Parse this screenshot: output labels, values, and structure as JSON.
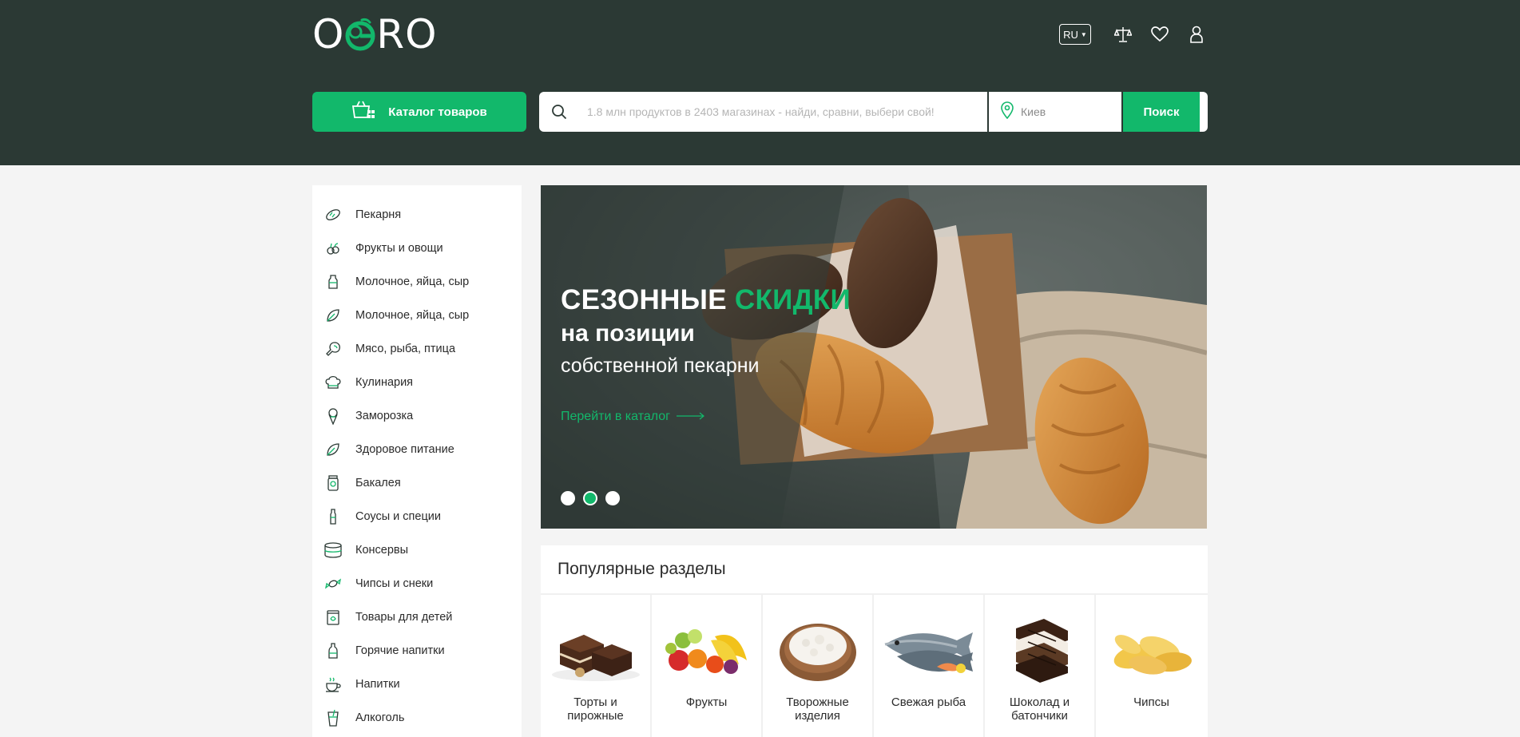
{
  "header": {
    "logo_text_left": "O",
    "logo_text_right": "RO",
    "lang": "RU",
    "icons": [
      "compare-scales-icon",
      "heart-icon",
      "user-icon"
    ]
  },
  "catalog_button": "Каталог товаров",
  "search": {
    "placeholder": "1.8 млн продуктов в 2403 магазинах - найди, сравни, выбери свой!",
    "city_placeholder": "Киев",
    "button": "Поиск"
  },
  "sidebar": {
    "items": [
      {
        "label": "Пекарня",
        "icon": "bread-icon"
      },
      {
        "label": "Фрукты и овощи",
        "icon": "fruit-icon"
      },
      {
        "label": "Молочное, яйца, сыр",
        "icon": "milk-icon"
      },
      {
        "label": "Молочное, яйца, сыр",
        "icon": "leaf-icon"
      },
      {
        "label": "Мясо, рыба, птица",
        "icon": "chicken-leg-icon"
      },
      {
        "label": "Кулинария",
        "icon": "chef-hat-icon"
      },
      {
        "label": "Заморозка",
        "icon": "ice-cream-icon"
      },
      {
        "label": "Здоровое питание",
        "icon": "leaf-icon"
      },
      {
        "label": "Бакалея",
        "icon": "jar-icon"
      },
      {
        "label": "Соусы и специи",
        "icon": "sauce-bottle-icon"
      },
      {
        "label": "Консервы",
        "icon": "can-icon"
      },
      {
        "label": "Чипсы и снеки",
        "icon": "candy-icon"
      },
      {
        "label": "Товары для детей",
        "icon": "baby-food-icon"
      },
      {
        "label": "Горячие напитки",
        "icon": "bottle-icon"
      },
      {
        "label": "Напитки",
        "icon": "coffee-cup-icon"
      },
      {
        "label": "Алкоголь",
        "icon": "cocktail-icon"
      }
    ]
  },
  "banner": {
    "line1_white": "СЕЗОННЫЕ",
    "line1_green": "СКИДКИ",
    "line2": "на позиции",
    "line3": "собственной пекарни",
    "link": "Перейти в каталог",
    "active_slide": 2,
    "slides": 3
  },
  "popular": {
    "title": "Популярные разделы",
    "cards": [
      {
        "label": "Торты и пирожные",
        "image": "cakes"
      },
      {
        "label": "Фрукты",
        "image": "fruits"
      },
      {
        "label": "Творожные изделия",
        "image": "cottage-cheese"
      },
      {
        "label": "Свежая рыба",
        "image": "fish"
      },
      {
        "label": "Шоколад и батончики",
        "image": "chocolate"
      },
      {
        "label": "Чипсы",
        "image": "chips"
      }
    ]
  },
  "colors": {
    "header_bg": "#2b3934",
    "accent": "#12b86b",
    "page_bg": "#f4f4f4"
  }
}
